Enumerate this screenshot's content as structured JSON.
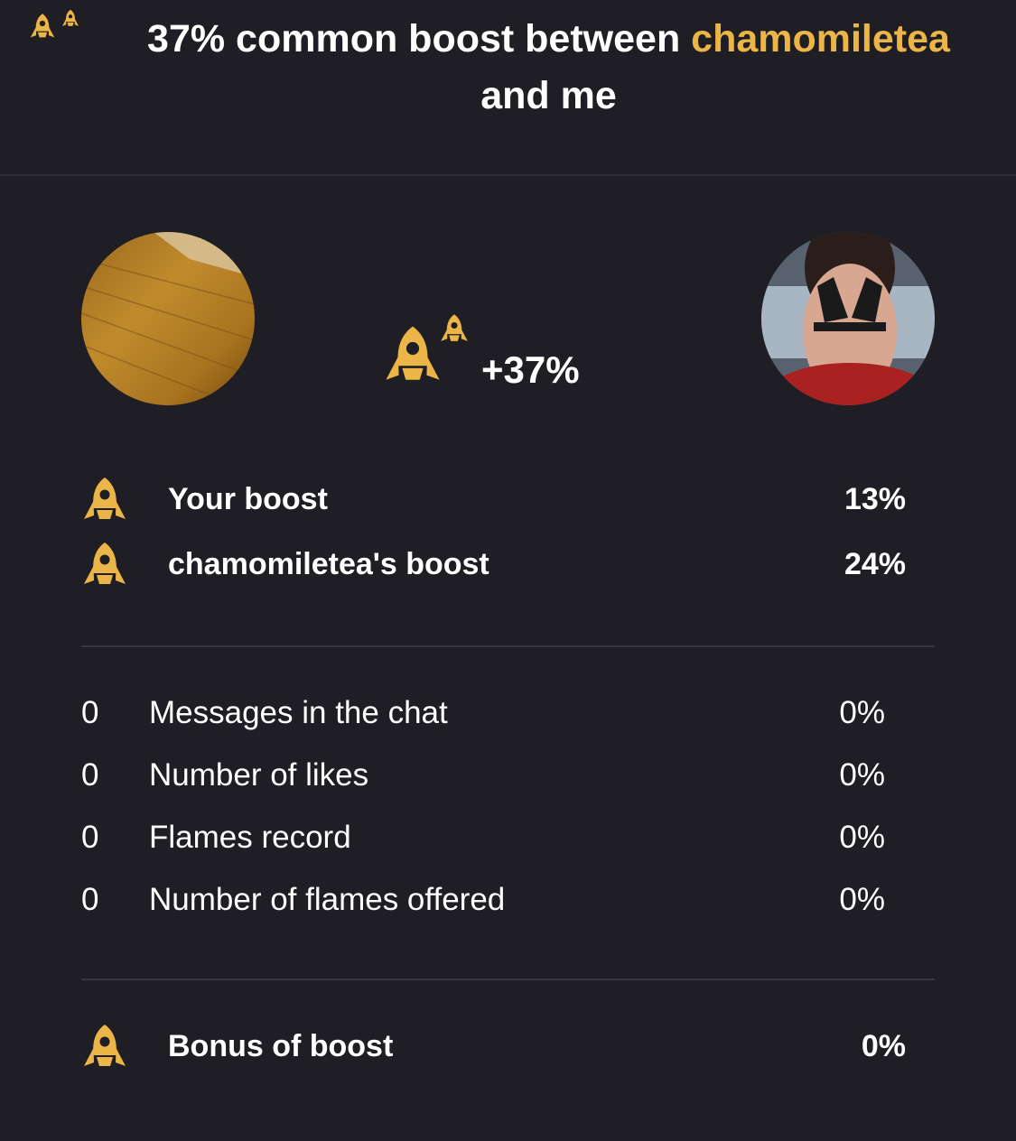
{
  "header": {
    "title_prefix": "37% common boost between ",
    "username": "chamomiletea",
    "title_suffix": "and me"
  },
  "center_boost": {
    "value": "+37%"
  },
  "boosts": [
    {
      "label": "Your boost",
      "value": "13%"
    },
    {
      "label": "chamomiletea's boost",
      "value": "24%"
    }
  ],
  "stats": [
    {
      "count": "0",
      "label": "Messages in the chat",
      "value": "0%"
    },
    {
      "count": "0",
      "label": "Number of likes",
      "value": "0%"
    },
    {
      "count": "0",
      "label": "Flames record",
      "value": "0%"
    },
    {
      "count": "0",
      "label": "Number of flames offered",
      "value": "0%"
    }
  ],
  "bonus": {
    "label": "Bonus of boost",
    "value": "0%"
  },
  "colors": {
    "accent": "#ecb547",
    "background": "#1e1e24",
    "divider": "#36363d"
  },
  "icons": {
    "header": "double-rocket-icon",
    "center": "double-rocket-icon",
    "row": "rocket-icon"
  }
}
